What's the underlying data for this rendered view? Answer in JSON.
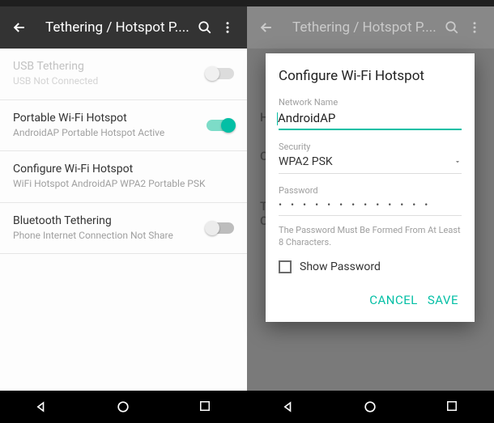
{
  "left": {
    "title": "Tethering / Hotspot P....",
    "rows": {
      "usb": {
        "title": "USB Tethering",
        "sub": "USB Not Connected"
      },
      "wifi": {
        "title": "Portable Wi-Fi Hotspot",
        "sub": "AndroidAP Portable Hotspot Active"
      },
      "configure": {
        "title": "Configure Wi-Fi Hotspot",
        "sub": "WiFi Hotspot AndroidAP WPA2 Portable PSK"
      },
      "bt": {
        "title": "Bluetooth Tethering",
        "sub": "Phone Internet Connection Not Share"
      }
    }
  },
  "right": {
    "title": "Tethering / Hotspot P....",
    "bg": {
      "h": "H",
      "c": "C",
      "t": "T",
      "c2": "C"
    },
    "dialog": {
      "heading": "Configure Wi-Fi Hotspot",
      "network_label": "Network Name",
      "network_value": "AndroidAP",
      "security_label": "Security",
      "security_value": "WPA2 PSK",
      "password_label": "Password",
      "password_value": "•  •  •  •  •  •  •  •  •  •  •  •  •",
      "hint": "The Password Must Be Formed From At Least 8 Characters.",
      "show_password": "Show Password",
      "cancel": "CANCEL",
      "save": "SAVE"
    }
  }
}
